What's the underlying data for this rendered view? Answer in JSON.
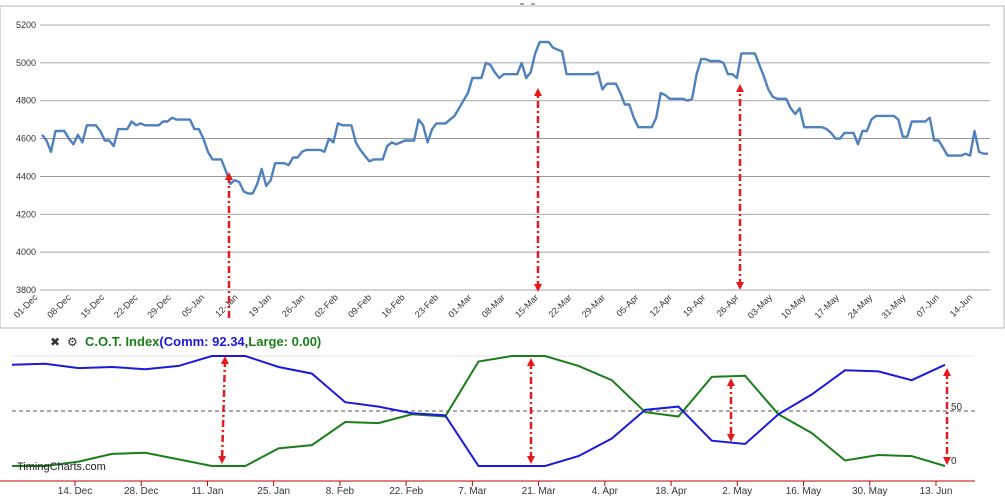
{
  "chart_data": [
    {
      "type": "line",
      "title": "",
      "xlabel": "",
      "ylabel": "",
      "ylim": [
        3800,
        5200
      ],
      "yticks": [
        3800,
        4000,
        4200,
        4400,
        4600,
        4800,
        5000,
        5200
      ],
      "grid": "horizontal",
      "categories": [
        "01-Dec",
        "08-Dec",
        "15-Dec",
        "22-Dec",
        "29-Dec",
        "05-Jan",
        "12-Jan",
        "19-Jan",
        "26-Jan",
        "02-Feb",
        "09-Feb",
        "16-Feb",
        "23-Feb",
        "01-Mar",
        "08-Mar",
        "15-Mar",
        "22-Mar",
        "29-Mar",
        "05-Apr",
        "12-Apr",
        "19-Apr",
        "26-Apr",
        "03-May",
        "10-May",
        "17-May",
        "24-May",
        "31-May",
        "07-Jun",
        "14-Jun"
      ],
      "series": [
        {
          "color": "#4f81bd",
          "values": [
            4620,
            4590,
            4530,
            4640,
            4640,
            4640,
            4600,
            4570,
            4620,
            4580,
            4670,
            4670,
            4670,
            4640,
            4590,
            4590,
            4560,
            4650,
            4650,
            4650,
            4690,
            4670,
            4680,
            4670,
            4670,
            4670,
            4670,
            4690,
            4690,
            4710,
            4700,
            4700,
            4700,
            4700,
            4650,
            4650,
            4600,
            4530,
            4490,
            4490,
            4490,
            4430,
            4360,
            4380,
            4370,
            4320,
            4310,
            4310,
            4360,
            4440,
            4350,
            4380,
            4470,
            4470,
            4470,
            4460,
            4500,
            4500,
            4530,
            4540,
            4540,
            4540,
            4540,
            4530,
            4600,
            4580,
            4680,
            4670,
            4670,
            4670,
            4580,
            4540,
            4510,
            4480,
            4490,
            4490,
            4490,
            4560,
            4580,
            4570,
            4580,
            4590,
            4590,
            4590,
            4700,
            4670,
            4580,
            4650,
            4680,
            4680,
            4680,
            4700,
            4720,
            4760,
            4800,
            4840,
            4920,
            4920,
            4920,
            5000,
            4990,
            4950,
            4920,
            4940,
            4940,
            4940,
            4940,
            5000,
            4920,
            4950,
            5050,
            5110,
            5110,
            5110,
            5080,
            5070,
            5060,
            4940,
            4940,
            4940,
            4940,
            4940,
            4940,
            4940,
            4950,
            4860,
            4890,
            4890,
            4890,
            4840,
            4780,
            4780,
            4710,
            4660,
            4660,
            4660,
            4660,
            4710,
            4840,
            4830,
            4810,
            4810,
            4810,
            4810,
            4800,
            4810,
            4940,
            5020,
            5020,
            5010,
            5010,
            5010,
            5000,
            4940,
            4940,
            4920,
            5050,
            5050,
            5050,
            5050,
            4990,
            4930,
            4860,
            4820,
            4810,
            4810,
            4810,
            4760,
            4730,
            4760,
            4660,
            4660,
            4660,
            4660,
            4660,
            4650,
            4630,
            4600,
            4600,
            4630,
            4630,
            4630,
            4570,
            4640,
            4640,
            4700,
            4720,
            4720,
            4720,
            4720,
            4720,
            4700,
            4610,
            4610,
            4690,
            4690,
            4690,
            4690,
            4710,
            4590,
            4590,
            4550,
            4510,
            4510,
            4510,
            4510,
            4520,
            4510,
            4640,
            4530,
            4520,
            4520
          ]
        }
      ]
    },
    {
      "type": "line",
      "title": "C.O.T. Index",
      "legend_text": {
        "prefix": "C.O.T. Index",
        "comm": "(Comm: 92.34",
        "sep": ",",
        "large": "Large: 0.00)"
      },
      "ylim": [
        0,
        100
      ],
      "yticks": [
        0,
        50
      ],
      "reference_line": 50,
      "categories": [
        "14. Dec",
        "28. Dec",
        "11. Jan",
        "25. Jan",
        "8. Feb",
        "22. Feb",
        "7. Mar",
        "21. Mar",
        "4. Apr",
        "18. Apr",
        "2. May",
        "16. May",
        "30. May",
        "13. Jun"
      ],
      "series": [
        {
          "name": "Comm",
          "color": "#1a1add",
          "points": [
            [
              0,
              92
            ],
            [
              1,
              93
            ],
            [
              2,
              89
            ],
            [
              3,
              90
            ],
            [
              4,
              88
            ],
            [
              5,
              91
            ],
            [
              6,
              100
            ],
            [
              7,
              100
            ],
            [
              8,
              90
            ],
            [
              9,
              84
            ],
            [
              10,
              58
            ],
            [
              11,
              54
            ],
            [
              12,
              48
            ],
            [
              13,
              46
            ],
            [
              14,
              0
            ],
            [
              15,
              0
            ],
            [
              16,
              0
            ],
            [
              17,
              9
            ],
            [
              18,
              25
            ],
            [
              19,
              51
            ],
            [
              20,
              54
            ],
            [
              21,
              23
            ],
            [
              22,
              20
            ],
            [
              23,
              47
            ],
            [
              24,
              65
            ],
            [
              25,
              87
            ],
            [
              26,
              86
            ],
            [
              27,
              78
            ],
            [
              28,
              92
            ]
          ]
        },
        {
          "name": "Large",
          "color": "#1a7f1a",
          "points": [
            [
              0,
              0
            ],
            [
              1,
              0
            ],
            [
              2,
              4
            ],
            [
              3,
              11
            ],
            [
              4,
              12
            ],
            [
              5,
              6
            ],
            [
              6,
              0
            ],
            [
              7,
              0
            ],
            [
              8,
              16
            ],
            [
              9,
              19
            ],
            [
              10,
              40
            ],
            [
              11,
              39
            ],
            [
              12,
              47
            ],
            [
              13,
              45
            ],
            [
              14,
              95
            ],
            [
              15,
              100
            ],
            [
              16,
              100
            ],
            [
              17,
              91
            ],
            [
              18,
              78
            ],
            [
              19,
              49
            ],
            [
              20,
              45
            ],
            [
              21,
              81
            ],
            [
              22,
              82
            ],
            [
              23,
              47
            ],
            [
              24,
              30
            ],
            [
              25,
              5
            ],
            [
              26,
              10
            ],
            [
              27,
              9
            ],
            [
              28,
              0
            ]
          ]
        }
      ]
    }
  ],
  "annotations": {
    "arrow_color": "#e41a1c"
  },
  "toolbar": {
    "close_icon": "✖",
    "settings_icon": "⚙"
  },
  "watermark": "TimingCharts.com"
}
